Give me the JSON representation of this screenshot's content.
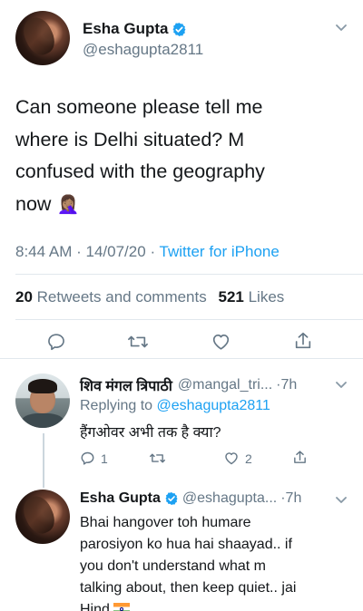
{
  "main_tweet": {
    "author": {
      "name": "Esha Gupta",
      "handle": "@eshagupta2811",
      "verified": true
    },
    "text_lines": [
      "Can someone please tell me",
      "where is Delhi situated? M",
      "confused with the geography",
      "now"
    ],
    "emoji": "🤦🏽‍♀️",
    "time": "8:44 AM",
    "date": "14/07/20",
    "separator": "·",
    "source": "Twitter for iPhone",
    "retweets_count": "20",
    "retweets_label": "Retweets and comments",
    "likes_count": "521",
    "likes_label": "Likes"
  },
  "replies": [
    {
      "author": {
        "name": "शिव मंगल त्रिपाठी",
        "handle": "@mangal_tri...",
        "verified": false
      },
      "separator": "·",
      "time": "7h",
      "replying_label": "Replying to",
      "replying_to": "@eshagupta2811",
      "text": "हैंगओवर अभी तक है क्या?",
      "reply_count": "1",
      "like_count": "2"
    },
    {
      "author": {
        "name": "Esha Gupta",
        "handle": "@eshagupta...",
        "verified": true
      },
      "separator": "·",
      "time": "7h",
      "text_lines": [
        "Bhai hangover toh humare",
        "parosiyon ko hua hai shaayad.. if",
        "you don't understand what m",
        "talking about, then keep quiet.. jai",
        "Hind"
      ]
    }
  ],
  "icons": {
    "verified": "verified-badge-icon",
    "chevron": "chevron-down-icon",
    "reply": "reply-icon",
    "retweet": "retweet-icon",
    "like": "heart-icon",
    "share": "share-icon",
    "flag": "india-flag-icon"
  },
  "colors": {
    "accent": "#1da1f2",
    "text": "#14171a",
    "muted": "#657786",
    "divider": "#e1e8ed"
  }
}
